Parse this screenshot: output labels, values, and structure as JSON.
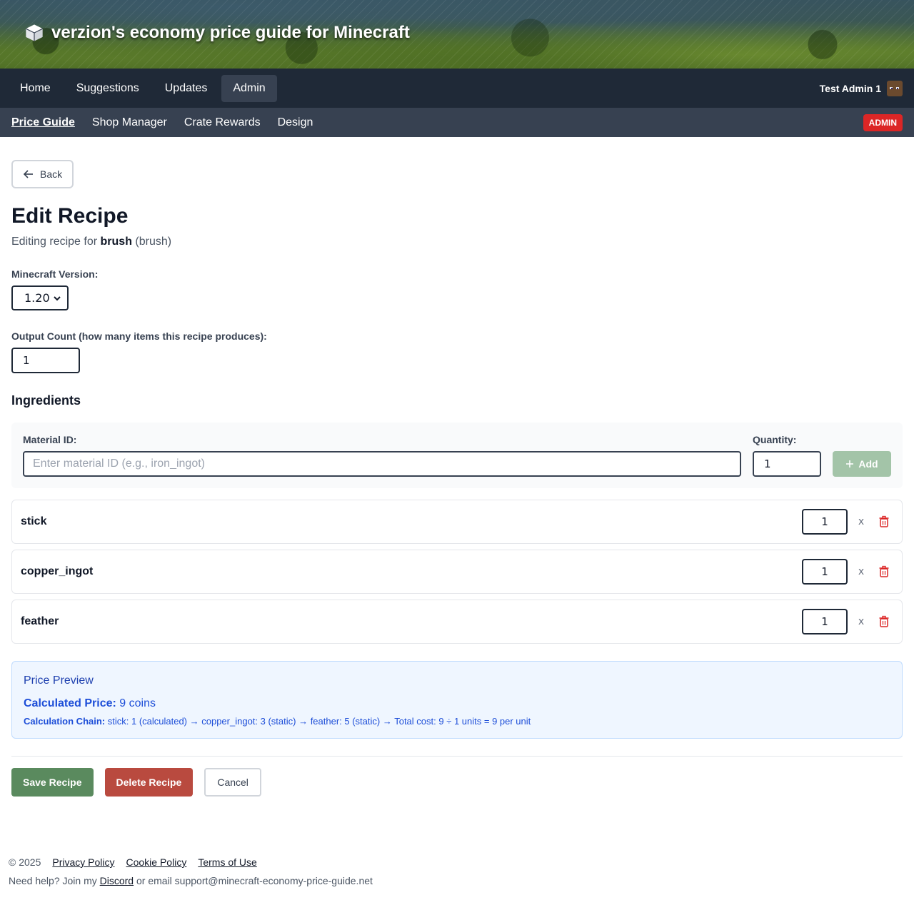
{
  "banner": {
    "title": "verzion's economy price guide for Minecraft"
  },
  "mainnav": {
    "items": [
      {
        "label": "Home"
      },
      {
        "label": "Suggestions"
      },
      {
        "label": "Updates"
      },
      {
        "label": "Admin"
      }
    ],
    "active_index": 3,
    "user": {
      "name": "Test Admin 1"
    }
  },
  "subnav": {
    "items": [
      {
        "label": "Price Guide"
      },
      {
        "label": "Shop Manager"
      },
      {
        "label": "Crate Rewards"
      },
      {
        "label": "Design"
      }
    ],
    "badge": "ADMIN"
  },
  "page": {
    "back_label": "Back",
    "title": "Edit Recipe",
    "subtitle_prefix": "Editing recipe for",
    "item_name": "brush",
    "item_id": "(brush)",
    "version_label": "Minecraft Version:",
    "version_value": "1.20",
    "output_label": "Output Count (how many items this recipe produces):",
    "output_value": "1",
    "ingredients_heading": "Ingredients",
    "add_form": {
      "material_label": "Material ID:",
      "material_placeholder": "Enter material ID (e.g., iron_ingot)",
      "quantity_label": "Quantity:",
      "quantity_value": "1",
      "add_label": "Add"
    },
    "ingredients": [
      {
        "name": "stick",
        "qty": "1",
        "x": "x"
      },
      {
        "name": "copper_ingot",
        "qty": "1",
        "x": "x"
      },
      {
        "name": "feather",
        "qty": "1",
        "x": "x"
      }
    ],
    "preview": {
      "title": "Price Preview",
      "price_label": "Calculated Price:",
      "price_value": "9 coins",
      "chain_label": "Calculation Chain:",
      "chain_value": "stick: 1 (calculated) → copper_ingot: 3 (static) → feather: 5 (static) → Total cost: 9 ÷ 1 units = 9 per unit"
    },
    "actions": {
      "save": "Save Recipe",
      "delete": "Delete Recipe",
      "cancel": "Cancel"
    }
  },
  "footer": {
    "copyright": "© 2025",
    "links": [
      "Privacy Policy",
      "Cookie Policy",
      "Terms of Use"
    ],
    "help_prefix": "Need help? Join my",
    "discord": "Discord",
    "help_suffix": "or email support@minecraft-economy-price-guide.net"
  },
  "colors": {
    "nav_bg": "#1f2937",
    "subnav_bg": "#374151",
    "admin_badge": "#dc2626",
    "save": "#5a8a5e",
    "delete": "#b94a3f",
    "preview_bg": "#eff6ff",
    "preview_text": "#1d4ed8"
  },
  "icons": [
    "cube-icon",
    "avatar",
    "arrow-left-icon",
    "plus-icon",
    "trash-icon",
    "chevron-down-icon"
  ]
}
